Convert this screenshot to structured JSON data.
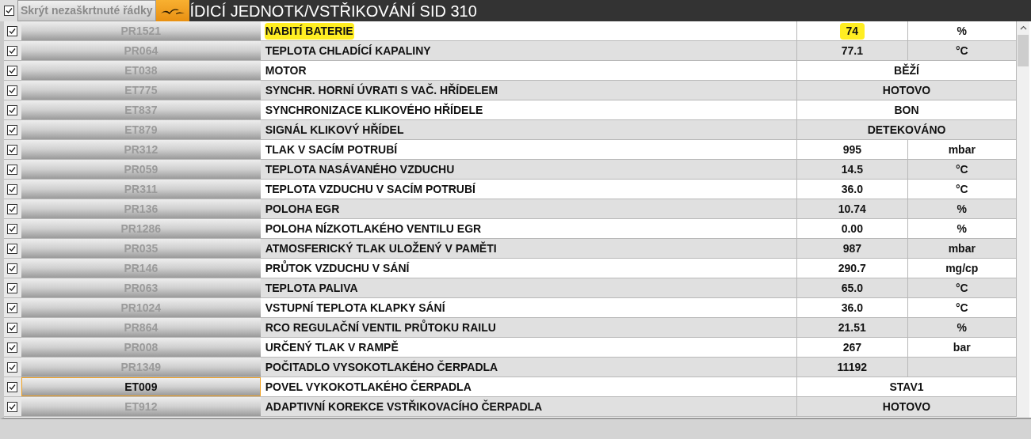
{
  "toolbar": {
    "show_all_checked": true,
    "hide_button": "Skrýt nezaškrtnuté řádky",
    "title": "ÍDICÍ JEDNOTK/VSTŘIKOVÁNÍ SID 310"
  },
  "rows": [
    {
      "kind": "measure",
      "checked": true,
      "selected": false,
      "highlighted": true,
      "code": "PR1521",
      "name": "NABITÍ BATERIE",
      "value": "74",
      "unit": "%"
    },
    {
      "kind": "measure",
      "checked": true,
      "selected": false,
      "highlighted": false,
      "code": "PR064",
      "name": "TEPLOTA CHLADÍCÍ KAPALINY",
      "value": "77.1",
      "unit": "°C"
    },
    {
      "kind": "state",
      "checked": true,
      "selected": false,
      "highlighted": false,
      "code": "ET038",
      "name": "MOTOR",
      "value": "BĚŽÍ"
    },
    {
      "kind": "state",
      "checked": true,
      "selected": false,
      "highlighted": false,
      "code": "ET775",
      "name": "SYNCHR. HORNÍ ÚVRATI S VAČ. HŘÍDELEM",
      "value": "HOTOVO"
    },
    {
      "kind": "state",
      "checked": true,
      "selected": false,
      "highlighted": false,
      "code": "ET837",
      "name": "SYNCHRONIZACE KLIKOVÉHO HŘÍDELE",
      "value": "BON"
    },
    {
      "kind": "state",
      "checked": true,
      "selected": false,
      "highlighted": false,
      "code": "ET879",
      "name": "SIGNÁL KLIKOVÝ HŘÍDEL",
      "value": "DETEKOVÁNO"
    },
    {
      "kind": "measure",
      "checked": true,
      "selected": false,
      "highlighted": false,
      "code": "PR312",
      "name": "TLAK V SACÍM POTRUBÍ",
      "value": "995",
      "unit": "mbar"
    },
    {
      "kind": "measure",
      "checked": true,
      "selected": false,
      "highlighted": false,
      "code": "PR059",
      "name": "TEPLOTA NASÁVANÉHO VZDUCHU",
      "value": "14.5",
      "unit": "°C"
    },
    {
      "kind": "measure",
      "checked": true,
      "selected": false,
      "highlighted": false,
      "code": "PR311",
      "name": "TEPLOTA VZDUCHU V SACÍM POTRUBÍ",
      "value": "36.0",
      "unit": "°C"
    },
    {
      "kind": "measure",
      "checked": true,
      "selected": false,
      "highlighted": false,
      "code": "PR136",
      "name": "POLOHA EGR",
      "value": "10.74",
      "unit": "%"
    },
    {
      "kind": "measure",
      "checked": true,
      "selected": false,
      "highlighted": false,
      "code": "PR1286",
      "name": "POLOHA NÍZKOTLAKÉHO VENTILU EGR",
      "value": "0.00",
      "unit": "%"
    },
    {
      "kind": "measure",
      "checked": true,
      "selected": false,
      "highlighted": false,
      "code": "PR035",
      "name": "ATMOSFERICKÝ TLAK ULOŽENÝ V PAMĚTI",
      "value": "987",
      "unit": "mbar"
    },
    {
      "kind": "measure",
      "checked": true,
      "selected": false,
      "highlighted": false,
      "code": "PR146",
      "name": "PRŮTOK VZDUCHU V SÁNÍ",
      "value": "290.7",
      "unit": "mg/cp"
    },
    {
      "kind": "measure",
      "checked": true,
      "selected": false,
      "highlighted": false,
      "code": "PR063",
      "name": "TEPLOTA PALIVA",
      "value": "65.0",
      "unit": "°C"
    },
    {
      "kind": "measure",
      "checked": true,
      "selected": false,
      "highlighted": false,
      "code": "PR1024",
      "name": "VSTUPNÍ TEPLOTA KLAPKY SÁNÍ",
      "value": "36.0",
      "unit": "°C"
    },
    {
      "kind": "measure",
      "checked": true,
      "selected": false,
      "highlighted": false,
      "code": "PR864",
      "name": "RCO REGULAČNÍ VENTIL PRŮTOKU RAILU",
      "value": "21.51",
      "unit": "%"
    },
    {
      "kind": "measure",
      "checked": true,
      "selected": false,
      "highlighted": false,
      "code": "PR008",
      "name": "URČENÝ TLAK V RAMPĚ",
      "value": "267",
      "unit": "bar"
    },
    {
      "kind": "measure",
      "checked": true,
      "selected": false,
      "highlighted": false,
      "code": "PR1349",
      "name": "POČITADLO VYSOKOTLAKÉHO ČERPADLA",
      "value": "11192"
    },
    {
      "kind": "state",
      "checked": true,
      "selected": true,
      "highlighted": false,
      "code": "ET009",
      "name": "POVEL VYKOKOTLAKÉHO ČERPADLA",
      "value": "STAV1"
    },
    {
      "kind": "state",
      "checked": true,
      "selected": false,
      "highlighted": false,
      "code": "ET912",
      "name": "ADAPTIVNÍ KOREKCE VSTŘIKOVACÍHO ČERPADLA",
      "value": "HOTOVO"
    }
  ]
}
